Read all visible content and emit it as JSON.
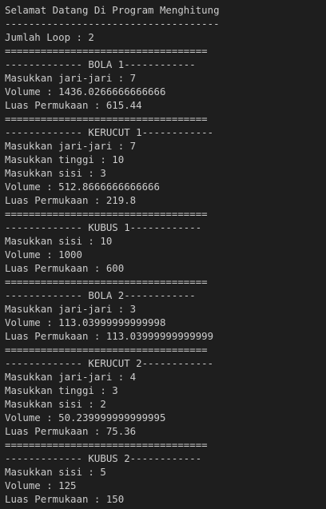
{
  "terminal": {
    "lines": [
      "Selamat Datang Di Program Menghitung",
      "------------------------------------",
      "Jumlah Loop : 2",
      "==================================",
      "------------- BOLA 1------------",
      "Masukkan jari-jari : 7",
      "Volume : 1436.0266666666666",
      "Luas Permukaan : 615.44",
      "==================================",
      "------------- KERUCUT 1------------",
      "Masukkan jari-jari : 7",
      "Masukkan tinggi : 10",
      "Masukkan sisi : 3",
      "Volume : 512.8666666666666",
      "Luas Permukaan : 219.8",
      "==================================",
      "------------- KUBUS 1------------",
      "Masukkan sisi : 10",
      "Volume : 1000",
      "Luas Permukaan : 600",
      "==================================",
      "------------- BOLA 2------------",
      "Masukkan jari-jari : 3",
      "Volume : 113.03999999999998",
      "Luas Permukaan : 113.03999999999999",
      "==================================",
      "------------- KERUCUT 2------------",
      "Masukkan jari-jari : 4",
      "Masukkan tinggi : 3",
      "Masukkan sisi : 2",
      "Volume : 50.239999999999995",
      "Luas Permukaan : 75.36",
      "==================================",
      "------------- KUBUS 2------------",
      "Masukkan sisi : 5",
      "Volume : 125",
      "Luas Permukaan : 150"
    ]
  }
}
